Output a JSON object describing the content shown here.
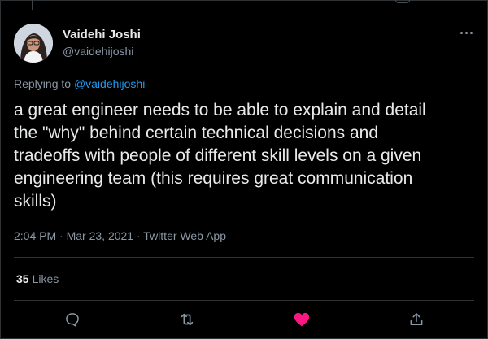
{
  "tweet": {
    "author_name": "Vaidehi Joshi",
    "author_handle": "@vaidehijoshi",
    "replying_prefix": "Replying to ",
    "replying_mention": "@vaidehijoshi",
    "text": "a great engineer needs to be able to explain and detail\nthe \"why\" behind certain technical decisions and\ntradeoffs with people of different skill levels on a given\nengineering team (this requires great communication\nskills)",
    "time": "2:04 PM",
    "date": "Mar 23, 2021",
    "source": "Twitter Web App",
    "likes_count": "35",
    "likes_label": "Likes"
  },
  "icons": {
    "reply": "reply-icon",
    "retweet": "retweet-icon",
    "like": "heart-icon",
    "share": "share-icon",
    "more": "more-icon"
  },
  "colors": {
    "background": "#000000",
    "text": "#e7e9ea",
    "muted": "#8b98a5",
    "link": "#1d9bf0",
    "like": "#f91880",
    "border": "#2f3336"
  }
}
